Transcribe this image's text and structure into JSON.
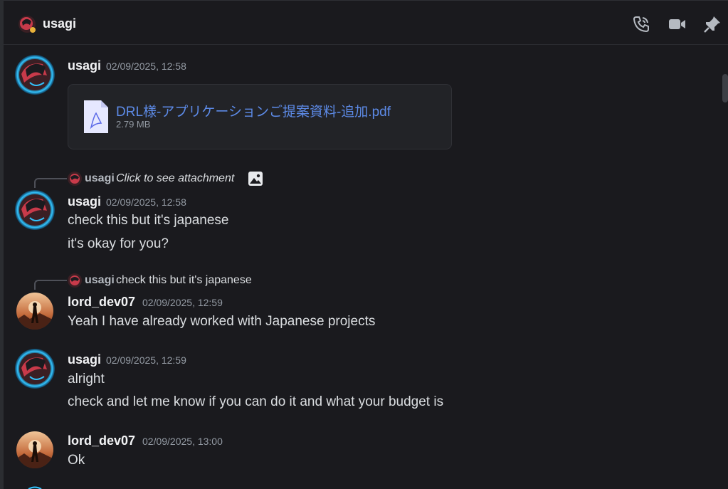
{
  "header": {
    "title": "usagi",
    "icons": [
      "phone-call-icon",
      "video-camera-icon",
      "pin-icon"
    ]
  },
  "messages": [
    {
      "author": "usagi",
      "timestamp": "02/09/2025, 12:58",
      "attachment": {
        "name": "DRL様-アプリケーションご提案資料-追加.pdf",
        "size": "2.79 MB"
      }
    },
    {
      "reply": {
        "author": "usagi",
        "text": "Click to see attachment"
      },
      "author": "usagi",
      "timestamp": "02/09/2025, 12:58",
      "lines": [
        "check this but it's japanese",
        "it's okay for you?"
      ]
    },
    {
      "reply": {
        "author": "usagi",
        "text": "check this but it's japanese"
      },
      "author": "lord_dev07",
      "timestamp": "02/09/2025, 12:59",
      "lines": [
        "Yeah I have already worked with Japanese projects"
      ]
    },
    {
      "author": "usagi",
      "timestamp": "02/09/2025, 12:59",
      "lines": [
        "alright",
        "check and let me know if you can do it and what your budget is"
      ]
    },
    {
      "author": "lord_dev07",
      "timestamp": "02/09/2025, 13:00",
      "lines": [
        "Ok"
      ]
    }
  ],
  "colors": {
    "background": "#1a1a1e",
    "link": "#5d8be8",
    "username": "#f2f3f5",
    "timestamp": "#949ba4",
    "accent_avatar_ring": "#33c4ff"
  }
}
